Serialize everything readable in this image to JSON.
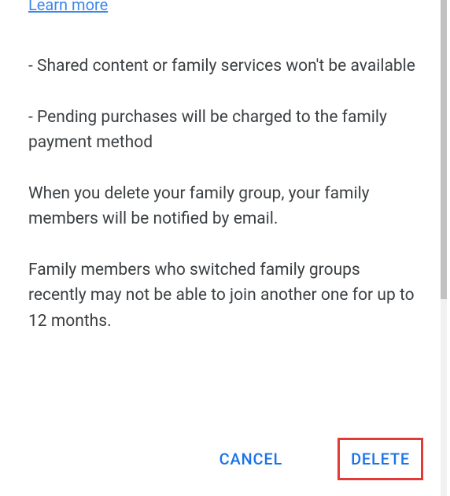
{
  "dialog": {
    "learn_more": "Learn more",
    "paragraphs": [
      "- Shared content or family services won't be available",
      "- Pending purchases will be charged to the family payment method",
      "When you delete your family group, your family members will be notified by email.",
      "Family members who switched family groups recently may not be able to join another one for up to 12 months."
    ],
    "actions": {
      "cancel": "CANCEL",
      "delete": "DELETE"
    }
  }
}
